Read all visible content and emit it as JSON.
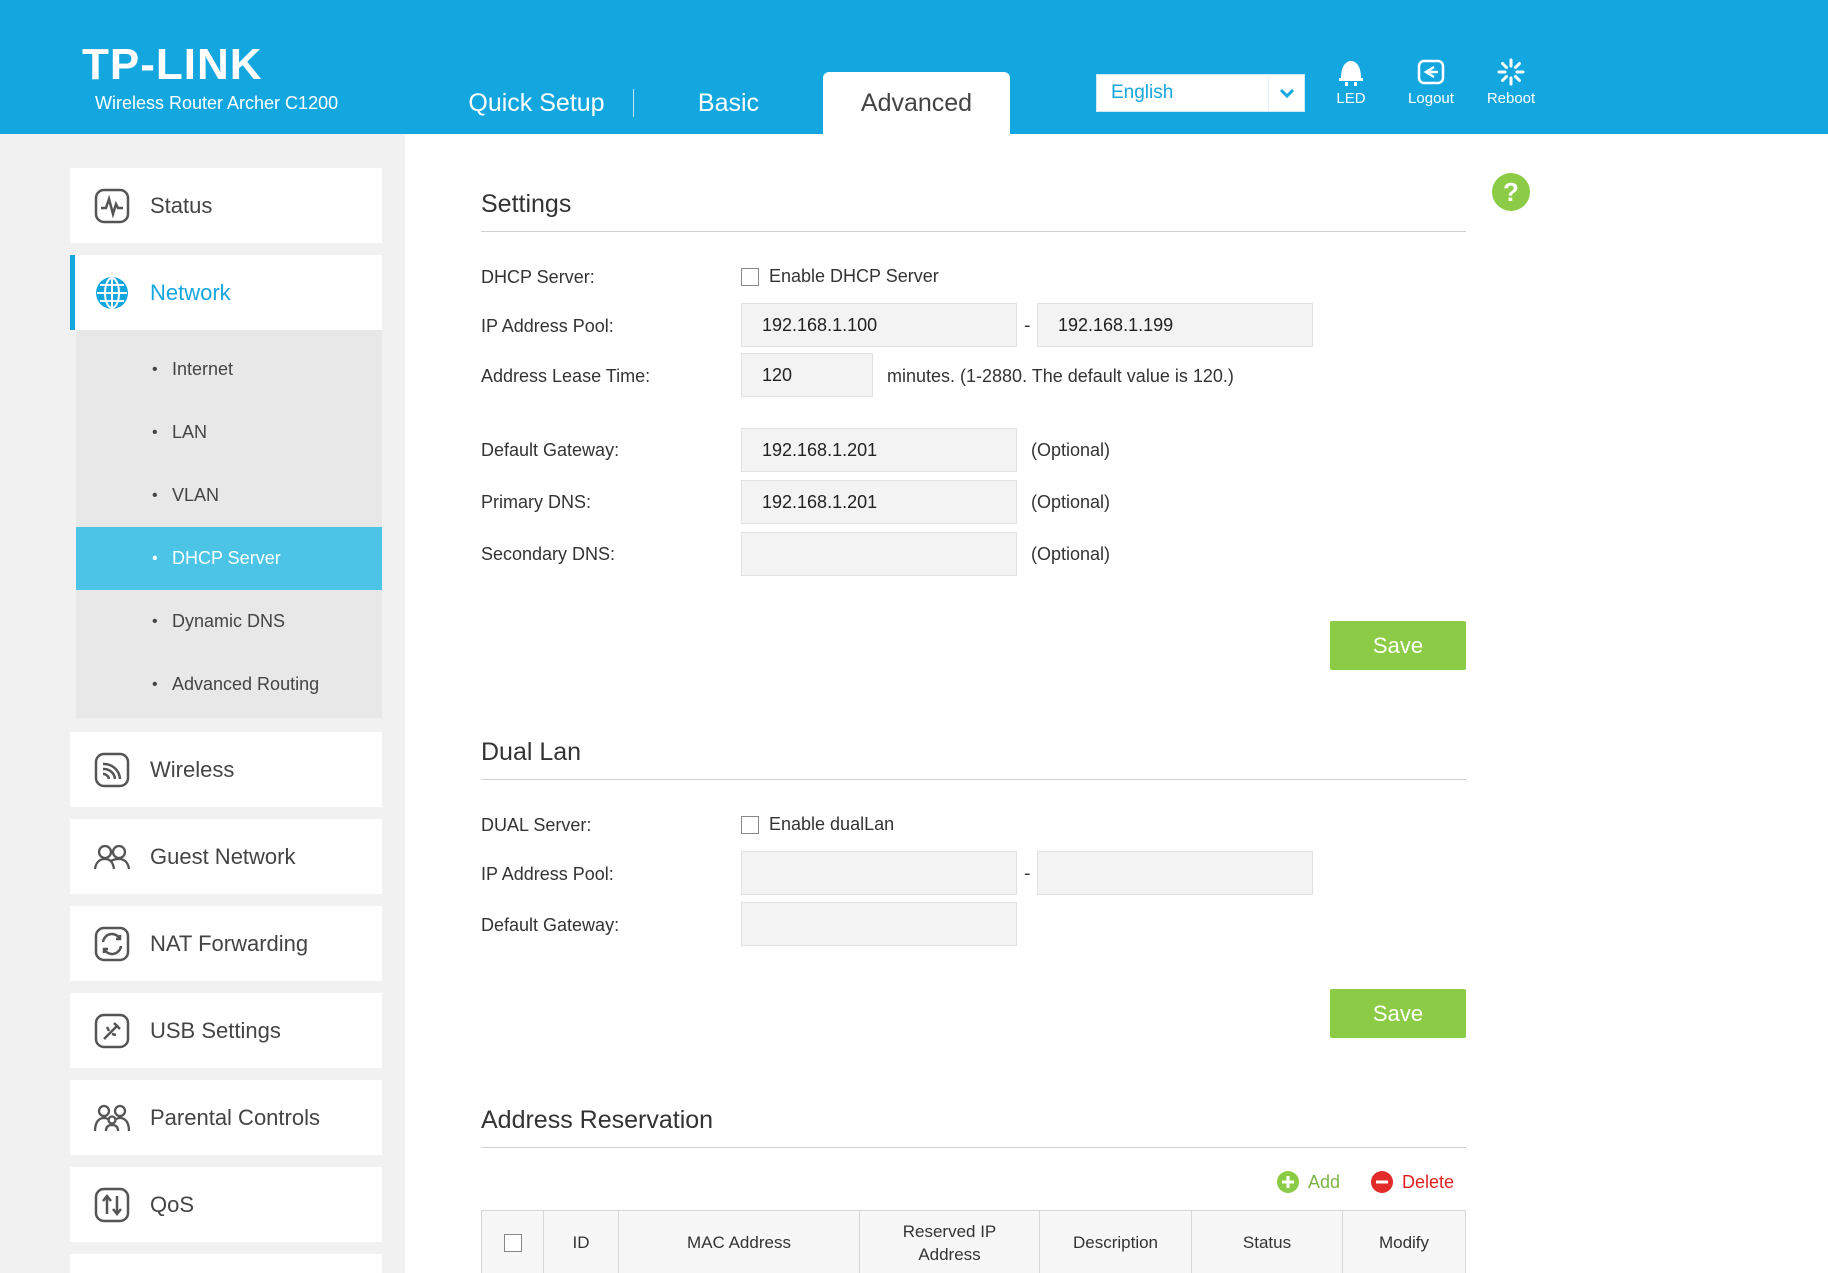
{
  "header": {
    "logo": "TP-LINK",
    "model": "Wireless Router Archer C1200",
    "tabs": [
      {
        "label": "Quick Setup"
      },
      {
        "label": "Basic"
      },
      {
        "label": "Advanced"
      }
    ],
    "active_tab": "Advanced",
    "language": {
      "selected": "English"
    },
    "buttons": {
      "led": "LED",
      "logout": "Logout",
      "reboot": "Reboot"
    },
    "colors": {
      "brand": "#14a7df",
      "accent_green": "#8ccb45",
      "sub_active": "#4cc4e6"
    }
  },
  "sidebar": {
    "items": [
      {
        "label": "Status",
        "icon": "status-icon"
      },
      {
        "label": "Network",
        "icon": "globe-icon",
        "active": true
      },
      {
        "label": "Wireless",
        "icon": "wireless-icon"
      },
      {
        "label": "Guest Network",
        "icon": "guest-icon"
      },
      {
        "label": "NAT Forwarding",
        "icon": "nat-icon"
      },
      {
        "label": "USB Settings",
        "icon": "usb-icon"
      },
      {
        "label": "Parental Controls",
        "icon": "parental-icon"
      },
      {
        "label": "QoS",
        "icon": "qos-icon"
      }
    ],
    "submenu": [
      {
        "label": "Internet"
      },
      {
        "label": "LAN"
      },
      {
        "label": "VLAN"
      },
      {
        "label": "DHCP Server",
        "active": true
      },
      {
        "label": "Dynamic DNS"
      },
      {
        "label": "Advanced Routing"
      }
    ]
  },
  "settings": {
    "title": "Settings",
    "dhcp_server_label": "DHCP Server:",
    "dhcp_enable_label": "Enable DHCP Server",
    "dhcp_enabled": false,
    "pool_label": "IP Address Pool:",
    "pool_start": "192.168.1.100",
    "pool_end": "192.168.1.199",
    "pool_dash": "-",
    "lease_label": "Address Lease Time:",
    "lease_value": "120",
    "lease_note": "minutes. (1-2880. The default value is 120.)",
    "gateway_label": "Default Gateway:",
    "gateway_value": "192.168.1.201",
    "primary_dns_label": "Primary DNS:",
    "primary_dns_value": "192.168.1.201",
    "secondary_dns_label": "Secondary DNS:",
    "secondary_dns_value": "",
    "optional": "(Optional)",
    "save": "Save"
  },
  "dual_lan": {
    "title": "Dual Lan",
    "server_label": "DUAL Server:",
    "enable_label": "Enable dualLan",
    "enabled": false,
    "pool_label": "IP Address Pool:",
    "pool_start": "",
    "pool_end": "",
    "pool_dash": "-",
    "gateway_label": "Default Gateway:",
    "gateway_value": "",
    "save": "Save"
  },
  "reservation": {
    "title": "Address Reservation",
    "add": "Add",
    "delete": "Delete",
    "columns": [
      "ID",
      "MAC Address",
      "Reserved IP Address",
      "Description",
      "Status",
      "Modify"
    ]
  },
  "help": "?"
}
